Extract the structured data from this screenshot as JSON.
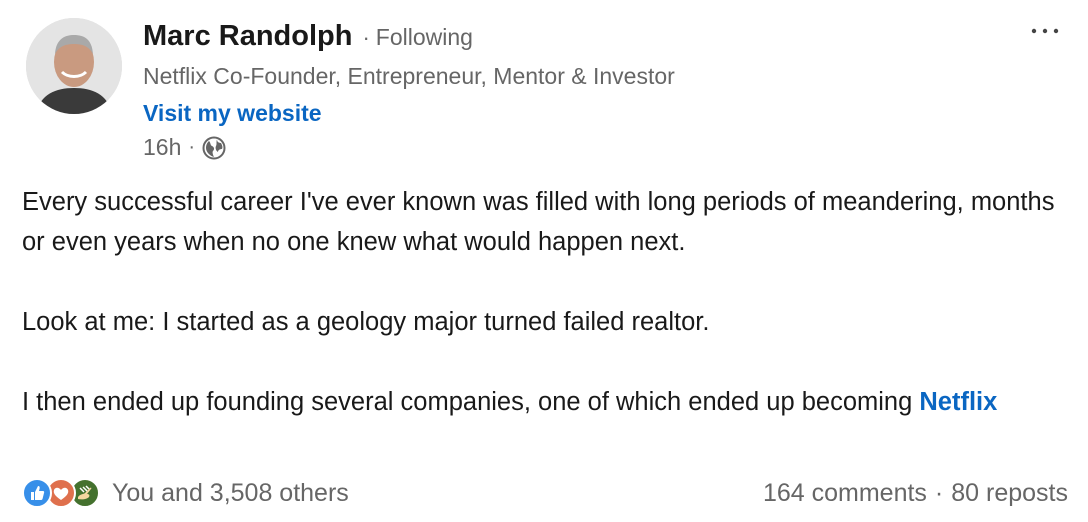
{
  "author": {
    "name": "Marc Randolph",
    "separator": "·",
    "follow_status": "Following",
    "headline": "Netflix Co-Founder, Entrepreneur, Mentor & Investor",
    "website_label": "Visit my website",
    "time": "16h",
    "time_separator": "·",
    "visibility_icon": "globe-icon"
  },
  "menu": {
    "more_icon": "more-options-icon"
  },
  "post": {
    "paragraph1": "Every successful career I've ever known was filled with long periods of meandering, months or even years when no one knew what would happen next.",
    "paragraph2": "Look at me: I started as a geology major turned failed realtor.",
    "paragraph3_prefix": "I then ended up founding several companies, one of which ended up becoming ",
    "paragraph3_link": "Netflix"
  },
  "social": {
    "reaction_icons": [
      "like-icon",
      "love-icon",
      "support-icon"
    ],
    "reactions_text": "You and 3,508 others",
    "comments": "164 comments",
    "separator": "·",
    "reposts": "80 reposts"
  },
  "colors": {
    "link": "#0a66c2",
    "secondary_text": "#666666",
    "like": "#378fe9",
    "love": "#df704d",
    "support": "#44712e"
  }
}
